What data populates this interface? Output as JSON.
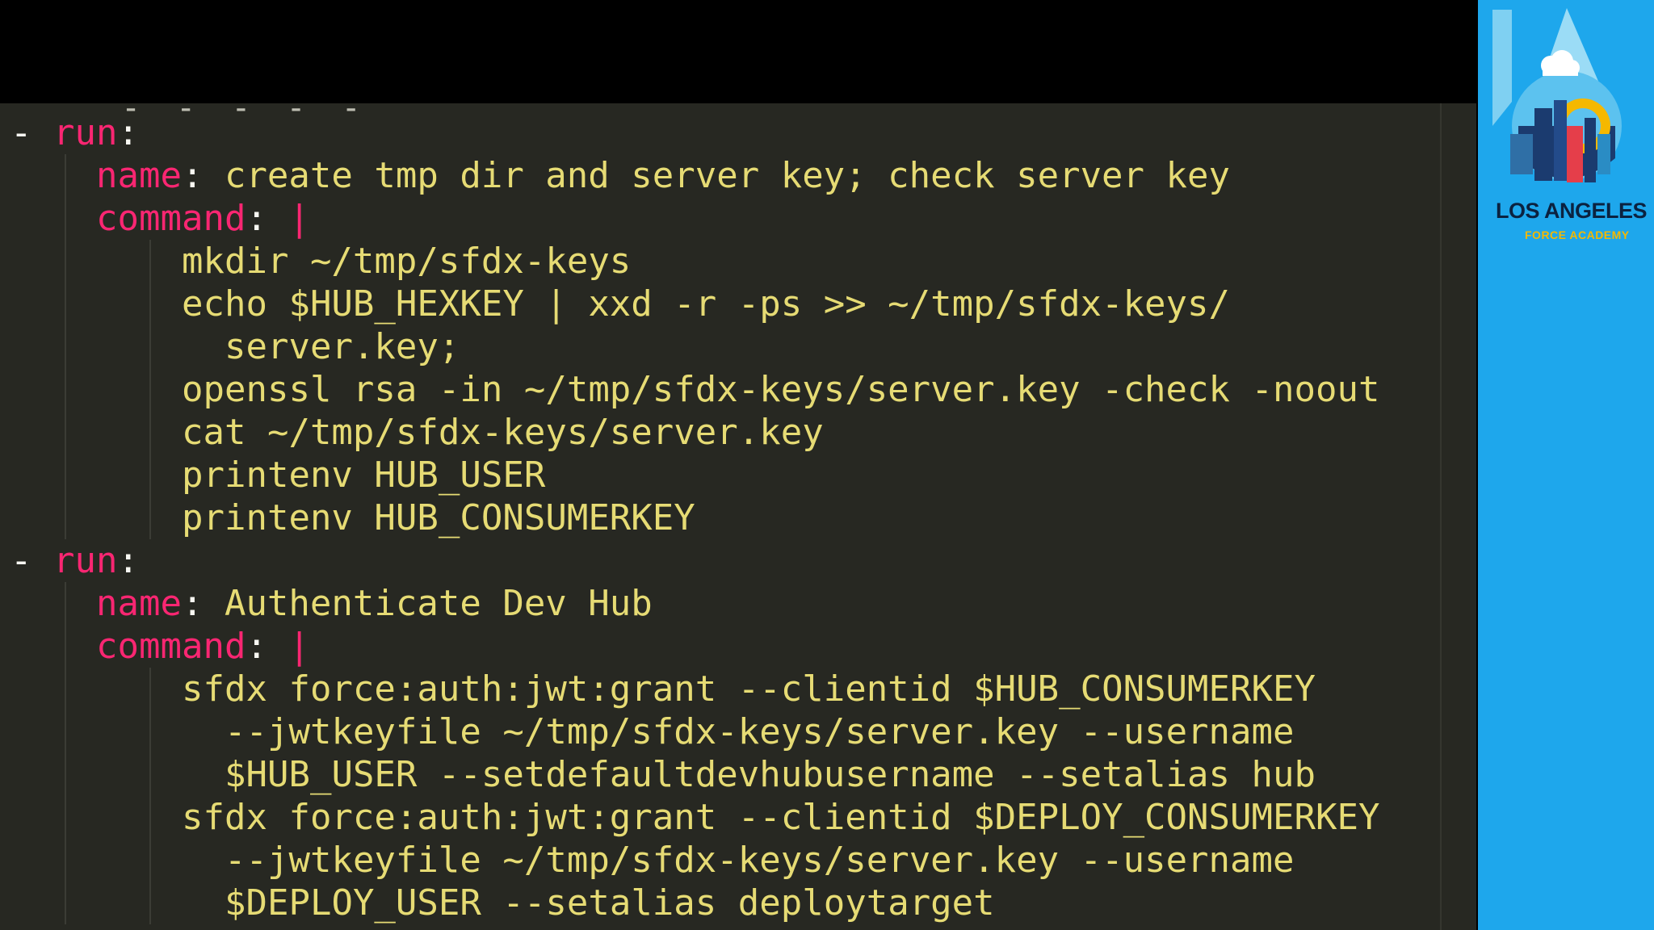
{
  "editor": {
    "lines": [
      {
        "indent": 0,
        "parts": [
          {
            "c": "dash",
            "t": "- "
          },
          {
            "c": "key",
            "t": "run"
          },
          {
            "c": "punct",
            "t": ":"
          }
        ]
      },
      {
        "indent": 2,
        "parts": [
          {
            "c": "key",
            "t": "name"
          },
          {
            "c": "punct",
            "t": ": "
          },
          {
            "c": "val",
            "t": "create tmp dir and server key; check server key"
          }
        ]
      },
      {
        "indent": 2,
        "parts": [
          {
            "c": "key",
            "t": "command"
          },
          {
            "c": "punct",
            "t": ": "
          },
          {
            "c": "pipe",
            "t": "|"
          }
        ]
      },
      {
        "indent": 4,
        "parts": [
          {
            "c": "cmd",
            "t": "mkdir ~/tmp/sfdx-keys"
          }
        ]
      },
      {
        "indent": 4,
        "parts": [
          {
            "c": "cmd",
            "t": "echo $HUB_HEXKEY | xxd -r -ps >> ~/tmp/sfdx-keys/"
          }
        ]
      },
      {
        "indent": 5,
        "parts": [
          {
            "c": "cmd",
            "t": "server.key;"
          }
        ]
      },
      {
        "indent": 4,
        "parts": [
          {
            "c": "cmd",
            "t": "openssl rsa -in ~/tmp/sfdx-keys/server.key -check -noout"
          }
        ]
      },
      {
        "indent": 4,
        "parts": [
          {
            "c": "cmd",
            "t": "cat ~/tmp/sfdx-keys/server.key"
          }
        ]
      },
      {
        "indent": 4,
        "parts": [
          {
            "c": "cmd",
            "t": "printenv HUB_USER"
          }
        ]
      },
      {
        "indent": 4,
        "parts": [
          {
            "c": "cmd",
            "t": "printenv HUB_CONSUMERKEY"
          }
        ]
      },
      {
        "indent": 0,
        "parts": [
          {
            "c": "dash",
            "t": "- "
          },
          {
            "c": "key",
            "t": "run"
          },
          {
            "c": "punct",
            "t": ":"
          }
        ]
      },
      {
        "indent": 2,
        "parts": [
          {
            "c": "key",
            "t": "name"
          },
          {
            "c": "punct",
            "t": ": "
          },
          {
            "c": "val",
            "t": "Authenticate Dev Hub"
          }
        ]
      },
      {
        "indent": 2,
        "parts": [
          {
            "c": "key",
            "t": "command"
          },
          {
            "c": "punct",
            "t": ": "
          },
          {
            "c": "pipe",
            "t": "|"
          }
        ]
      },
      {
        "indent": 4,
        "parts": [
          {
            "c": "cmd",
            "t": "sfdx force:auth:jwt:grant --clientid $HUB_CONSUMERKEY"
          }
        ]
      },
      {
        "indent": 5,
        "parts": [
          {
            "c": "cmd",
            "t": "--jwtkeyfile ~/tmp/sfdx-keys/server.key --username"
          }
        ]
      },
      {
        "indent": 5,
        "parts": [
          {
            "c": "cmd",
            "t": "$HUB_USER --setdefaultdevhubusername --setalias hub"
          }
        ]
      },
      {
        "indent": 4,
        "parts": [
          {
            "c": "cmd",
            "t": "sfdx force:auth:jwt:grant --clientid $DEPLOY_CONSUMERKEY"
          }
        ]
      },
      {
        "indent": 5,
        "parts": [
          {
            "c": "cmd",
            "t": "--jwtkeyfile ~/tmp/sfdx-keys/server.key --username"
          }
        ]
      },
      {
        "indent": 5,
        "parts": [
          {
            "c": "cmd",
            "t": "$DEPLOY_USER --setalias deploytarget"
          }
        ]
      }
    ]
  },
  "sidebar": {
    "logo_title": "LOS ANGELES",
    "logo_subtitle": "FORCE ACADEMY",
    "logo_icon": "la-skyline-logo-icon"
  },
  "colors": {
    "editor_bg": "#272822",
    "key": "#f92672",
    "string": "#e6db74",
    "sidebar_bg": "#1ea7ec"
  }
}
